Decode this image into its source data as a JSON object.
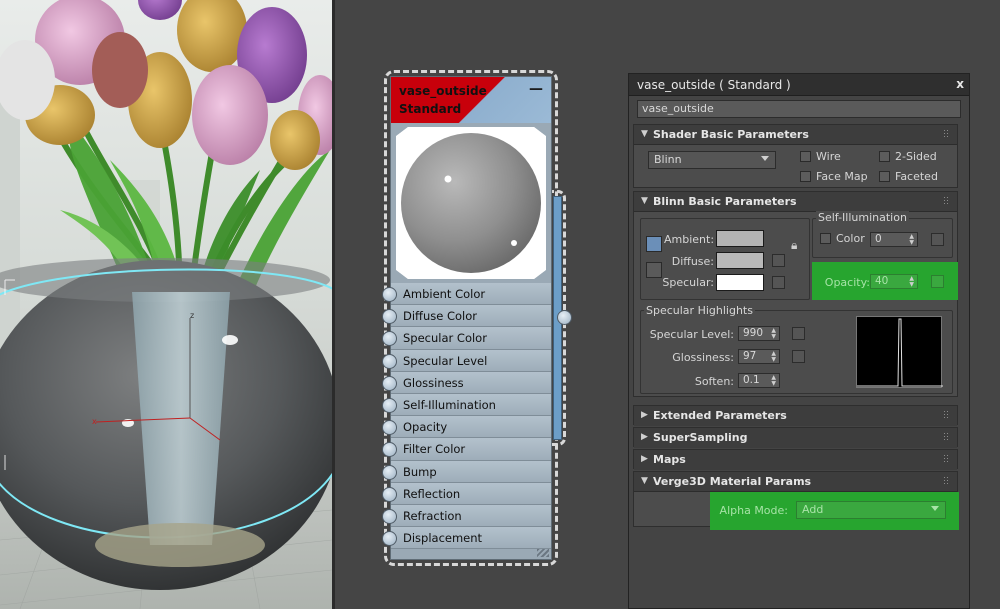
{
  "node": {
    "name": "vase_outside",
    "type": "Standard",
    "minimize_icon": "minus-icon",
    "slots": [
      "Ambient Color",
      "Diffuse Color",
      "Specular Color",
      "Specular Level",
      "Glossiness",
      "Self-Illumination",
      "Opacity",
      "Filter Color",
      "Bump",
      "Reflection",
      "Refraction",
      "Displacement"
    ]
  },
  "panel": {
    "title": "vase_outside  ( Standard )",
    "close": "x",
    "name_value": "vase_outside",
    "shader": {
      "title": "Shader Basic Parameters",
      "shader_value": "Blinn",
      "wire": "Wire",
      "two_sided": "2-Sided",
      "face_map": "Face Map",
      "faceted": "Faceted"
    },
    "blinn": {
      "title": "Blinn Basic Parameters",
      "ambient": "Ambient:",
      "diffuse": "Diffuse:",
      "specular": "Specular:",
      "self_illum_title": "Self-Illumination",
      "color_label": "Color",
      "color_value": "0",
      "opacity_label": "Opacity:",
      "opacity_value": "40",
      "spec_hl_title": "Specular Highlights",
      "spec_level_label": "Specular Level:",
      "spec_level_value": "990",
      "gloss_label": "Glossiness:",
      "gloss_value": "97",
      "soften_label": "Soften:",
      "soften_value": "0.1",
      "colors": {
        "ambient": "#b4b4b4",
        "diffuse": "#b9b9b9",
        "specular": "#ffffff",
        "highlight": "#27a52f"
      }
    },
    "rollouts": [
      {
        "title": "Extended Parameters"
      },
      {
        "title": "SuperSampling"
      },
      {
        "title": "Maps"
      }
    ],
    "verge": {
      "title": "Verge3D Material Params",
      "alpha_label": "Alpha Mode:",
      "alpha_value": "Add"
    }
  }
}
